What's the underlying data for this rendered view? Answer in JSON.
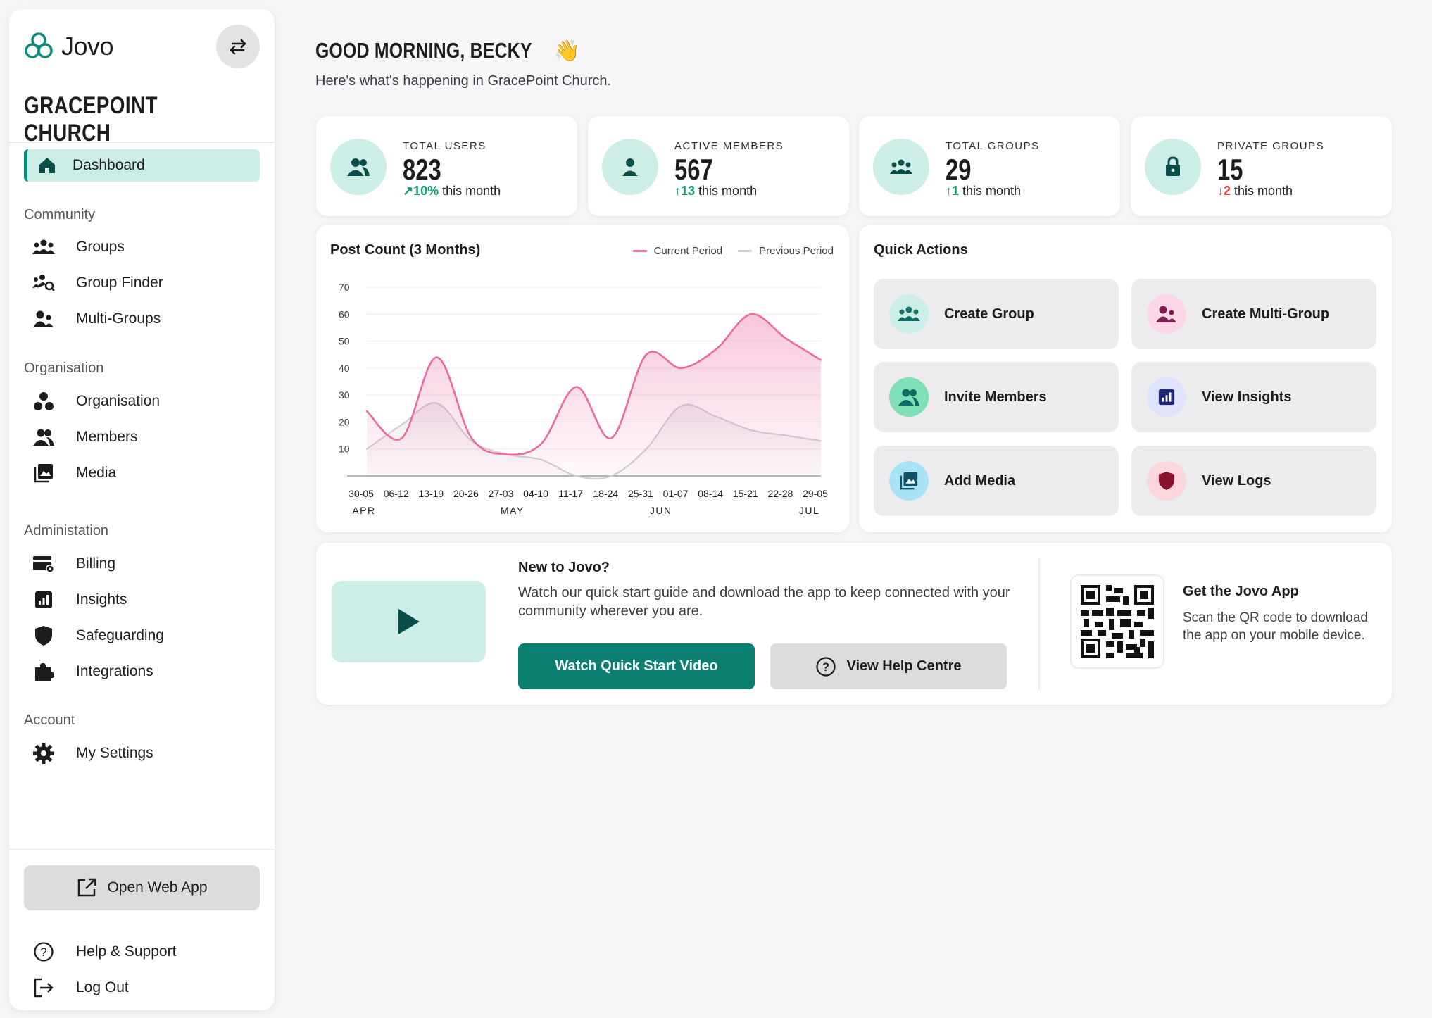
{
  "sidebar": {
    "brand": "Jovo",
    "org_name": "GRACEPOINT CHURCH",
    "active_item": "Dashboard",
    "sections": {
      "community": "Community",
      "organisation": "Organisation",
      "administration": "Administation",
      "account": "Account"
    },
    "items": {
      "groups": "Groups",
      "group_finder": "Group Finder",
      "multi_groups": "Multi-Groups",
      "organisation": "Organisation",
      "members": "Members",
      "media": "Media",
      "billing": "Billing",
      "insights": "Insights",
      "safeguarding": "Safeguarding",
      "integrations": "Integrations",
      "my_settings": "My Settings"
    },
    "open_web_app": "Open Web App",
    "help_support": "Help & Support",
    "log_out": "Log Out"
  },
  "header": {
    "greeting": "GOOD MORNING, BECKY",
    "greeting_emoji": "👋",
    "subtitle": "Here's what's happening in GracePoint Church."
  },
  "stats": [
    {
      "label": "TOTAL USERS",
      "value": "823",
      "delta": "10%",
      "direction": "up",
      "suffix": "this month",
      "icon": "users-icon"
    },
    {
      "label": "ACTIVE MEMBERS",
      "value": "567",
      "delta": "13",
      "direction": "up",
      "suffix": "this month",
      "icon": "person-icon"
    },
    {
      "label": "TOTAL GROUPS",
      "value": "29",
      "delta": "1",
      "direction": "up",
      "suffix": "this month",
      "icon": "groups-icon"
    },
    {
      "label": "PRIVATE GROUPS",
      "value": "15",
      "delta": "2",
      "direction": "down",
      "suffix": "this month",
      "icon": "lock-icon"
    }
  ],
  "chart_data": {
    "type": "area",
    "title": "Post Count (3 Months)",
    "x": [
      "30-05",
      "06-12",
      "13-19",
      "20-26",
      "27-03",
      "04-10",
      "11-17",
      "18-24",
      "25-31",
      "01-07",
      "08-14",
      "15-21",
      "22-28",
      "29-05"
    ],
    "months": [
      "APR",
      "MAY",
      "JUN",
      "JUL"
    ],
    "series": [
      {
        "name": "Current Period",
        "color": "#ec6aa1",
        "values": [
          24,
          14,
          44,
          14,
          8,
          12,
          33,
          14,
          45,
          40,
          47,
          60,
          51,
          43
        ]
      },
      {
        "name": "Previous Period",
        "color": "#cfcfd4",
        "values": [
          10,
          19,
          27,
          13,
          8,
          6,
          0,
          0,
          10,
          26,
          22,
          17,
          15,
          13
        ]
      }
    ],
    "yticks": [
      10,
      20,
      30,
      40,
      50,
      60,
      70
    ],
    "ylim": [
      0,
      70
    ],
    "grid": true,
    "legend": "top-right"
  },
  "quick_actions": {
    "title": "Quick Actions",
    "items": [
      {
        "label": "Create Group",
        "icon": "groups-icon",
        "bg": "#cdeee6",
        "fg": "#0d6e63"
      },
      {
        "label": "Create Multi-Group",
        "icon": "multi-group-icon",
        "bg": "#fbd6e6",
        "fg": "#7d1f4c"
      },
      {
        "label": "Invite Members",
        "icon": "members-icon",
        "bg": "#7fe0b7",
        "fg": "#0d6e63"
      },
      {
        "label": "View Insights",
        "icon": "insights-icon",
        "bg": "#dfe3fb",
        "fg": "#1f2a7a"
      },
      {
        "label": "Add Media",
        "icon": "media-icon",
        "bg": "#a8e4f5",
        "fg": "#0f5065"
      },
      {
        "label": "View Logs",
        "icon": "shield-icon",
        "bg": "#fbd6dc",
        "fg": "#8a1230"
      }
    ]
  },
  "onboarding": {
    "title": "New to Jovo?",
    "body": "Watch our quick start guide and download the app to keep connected with your community wherever you are.",
    "primary_button": "Watch Quick Start Video",
    "secondary_button": "View Help Centre",
    "app_title": "Get the Jovo App",
    "app_body": "Scan the QR code to download the app on your mobile device."
  },
  "colors": {
    "accent": "#0b7f72",
    "accent_light": "#cdeee6",
    "chart_current": "#ec6aa1",
    "chart_previous": "#cfcfd4"
  }
}
